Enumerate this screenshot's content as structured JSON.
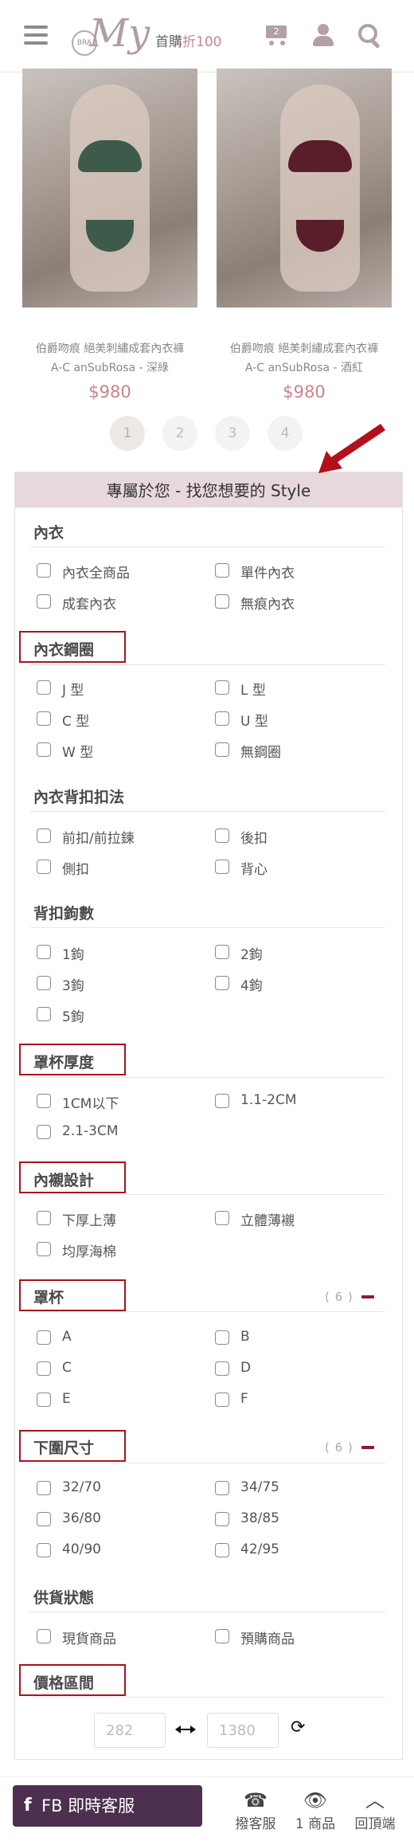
{
  "header": {
    "logo_bra": "BRA",
    "logo_my": "My",
    "promo_prefix": "首購",
    "promo_highlight": "折100",
    "cart_count": "2"
  },
  "products": [
    {
      "name_line1": "伯爵吻痕 絕美刺繡成套內衣褲",
      "name_line2": "A-C anSubRosa - 深綠",
      "price": "$980"
    },
    {
      "name_line1": "伯爵吻痕 絕美刺繡成套內衣褲",
      "name_line2": "A-C anSubRosa - 酒紅",
      "price": "$980"
    }
  ],
  "pagination": {
    "pages": [
      "1",
      "2",
      "3",
      "4"
    ],
    "active": "1"
  },
  "filter": {
    "title": "專屬於您 - 找您想要的 Style",
    "sections": [
      {
        "title": "內衣",
        "options": [
          "內衣全商品",
          "單件內衣",
          "成套內衣",
          "無痕內衣"
        ]
      },
      {
        "title": "內衣鋼圈",
        "options": [
          "J 型",
          "L 型",
          "C 型",
          "U 型",
          "W 型",
          "無鋼圈"
        ]
      },
      {
        "title": "內衣背扣扣法",
        "options": [
          "前扣/前拉鍊",
          "後扣",
          "側扣",
          "背心"
        ]
      },
      {
        "title": "背扣鉤數",
        "options": [
          "1鉤",
          "2鉤",
          "3鉤",
          "4鉤",
          "5鉤"
        ]
      },
      {
        "title": "罩杯厚度",
        "options": [
          "1CM以下",
          "1.1-2CM",
          "2.1-3CM"
        ]
      },
      {
        "title": "內襯設計",
        "options": [
          "下厚上薄",
          "立體薄襯",
          "均厚海棉"
        ]
      },
      {
        "title": "罩杯",
        "count": "( 6 )",
        "options": [
          "A",
          "B",
          "C",
          "D",
          "E",
          "F"
        ]
      },
      {
        "title": "下圍尺寸",
        "count": "( 6 )",
        "options": [
          "32/70",
          "34/75",
          "36/80",
          "38/85",
          "40/90",
          "42/95"
        ]
      },
      {
        "title": "供貨狀態",
        "options": [
          "現貨商品",
          "預購商品"
        ]
      },
      {
        "title": "價格區間",
        "min_placeholder": "282",
        "max_placeholder": "1380"
      }
    ]
  },
  "bottom_bar": {
    "fb_icon": "f",
    "fb_label": "FB 即時客服",
    "service_label": "撥客服",
    "items_label": "1 商品",
    "top_label": "回頂端"
  }
}
